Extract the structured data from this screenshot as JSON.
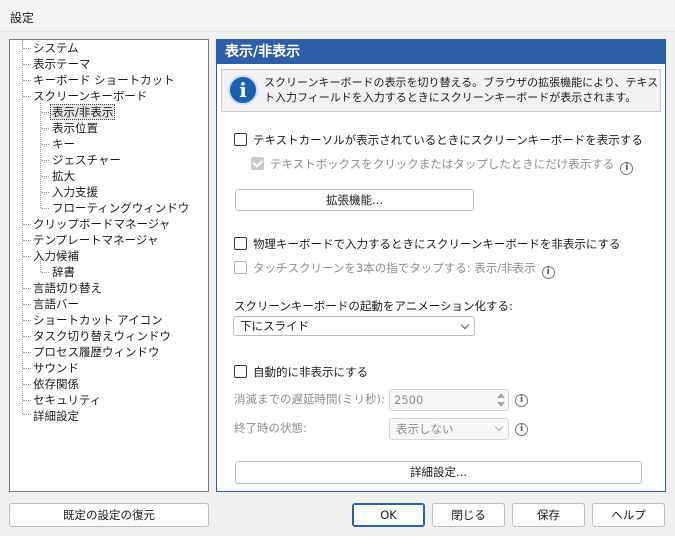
{
  "window": {
    "title": "設定"
  },
  "tree": {
    "items": [
      {
        "label": "システム"
      },
      {
        "label": "表示テーマ"
      },
      {
        "label": "キーボード ショートカット"
      },
      {
        "label": "スクリーンキーボード"
      },
      {
        "label": "表示/非表示"
      },
      {
        "label": "表示位置"
      },
      {
        "label": "キー"
      },
      {
        "label": "ジェスチャー"
      },
      {
        "label": "拡大"
      },
      {
        "label": "入力支援"
      },
      {
        "label": "フローティングウィンドウ"
      },
      {
        "label": "クリップボードマネージャ"
      },
      {
        "label": "テンプレートマネージャ"
      },
      {
        "label": "入力候補"
      },
      {
        "label": "辞書"
      },
      {
        "label": "言語切り替え"
      },
      {
        "label": "言語バー"
      },
      {
        "label": "ショートカット アイコン"
      },
      {
        "label": "タスク切り替えウィンドウ"
      },
      {
        "label": "プロセス履歴ウィンドウ"
      },
      {
        "label": "サウンド"
      },
      {
        "label": "依存関係"
      },
      {
        "label": "セキュリティ"
      },
      {
        "label": "詳細設定"
      }
    ]
  },
  "panel": {
    "title": "表示/非表示",
    "info": "スクリーンキーボードの表示を切り替える。ブラウザの拡張機能により、テキスト入力フィールドを入力するときにスクリーンキーボードが表示されます。",
    "opt_cursor": "テキストカーソルが表示されているときにスクリーンキーボードを表示する",
    "opt_textbox": "テキストボックスをクリックまたはタップしたときにだけ表示する",
    "btn_extension": "拡張機能...",
    "opt_physical": "物理キーボードで入力するときにスクリーンキーボードを非表示にする",
    "opt_touch": "タッチスクリーンを3本の指でタップする: 表示/非表示",
    "anim_label": "スクリーンキーボードの起動をアニメーション化する:",
    "anim_value": "下にスライド",
    "opt_autohide": "自動的に非表示にする",
    "delay_label": "消滅までの遅延時間(ミリ秒):",
    "delay_value": "2500",
    "endstate_label": "終了時の状態:",
    "endstate_value": "表示しない",
    "btn_advanced": "詳細設定...",
    "q_symbol": "i"
  },
  "footer": {
    "restore": "既定の設定の復元",
    "ok": "OK",
    "close": "閉じる",
    "save": "保存",
    "help": "ヘルプ"
  },
  "colors": {
    "accent": "#2f5ea8",
    "info_icon": "#1f5fb3"
  }
}
